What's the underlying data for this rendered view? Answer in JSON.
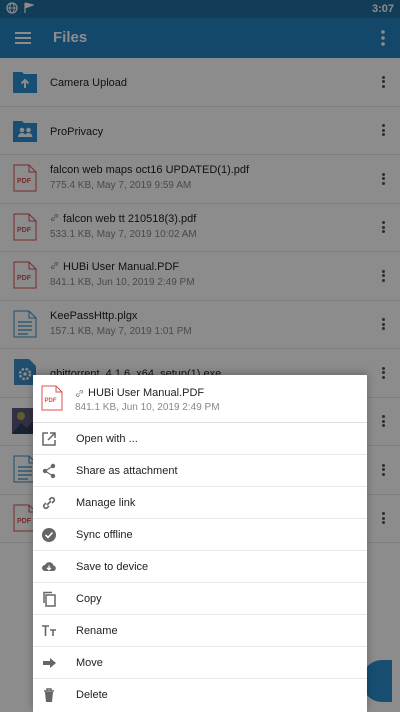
{
  "status": {
    "time": "3:07"
  },
  "appbar": {
    "title": "Files"
  },
  "files": [
    {
      "name": "Camera Upload",
      "meta": "",
      "type": "folder-upload",
      "linked": false
    },
    {
      "name": "ProPrivacy",
      "meta": "",
      "type": "folder-shared",
      "linked": false
    },
    {
      "name": "falcon web maps oct16 UPDATED(1).pdf",
      "meta": "775.4 KB, May 7, 2019 9:59 AM",
      "type": "pdf",
      "linked": false
    },
    {
      "name": "falcon web tt 210518(3).pdf",
      "meta": "533.1 KB, May 7, 2019 10:02 AM",
      "type": "pdf",
      "linked": true
    },
    {
      "name": "HUBi User Manual.PDF",
      "meta": "841.1 KB, Jun 10, 2019 2:49 PM",
      "type": "pdf",
      "linked": true
    },
    {
      "name": "KeePassHttp.plgx",
      "meta": "157.1 KB, May 7, 2019 1:01 PM",
      "type": "doc",
      "linked": false
    },
    {
      "name": "qbittorrent_4.1.6_x64_setup(1).exe",
      "meta": "",
      "type": "exe",
      "linked": false
    },
    {
      "name": "",
      "meta": "",
      "type": "image",
      "linked": false
    },
    {
      "name": "",
      "meta": "",
      "type": "doc",
      "linked": false
    },
    {
      "name": "",
      "meta": "",
      "type": "pdf",
      "linked": false
    }
  ],
  "sheet": {
    "file_name": "HUBi User Manual.PDF",
    "file_meta": "841.1 KB, Jun 10, 2019 2:49 PM",
    "actions": [
      {
        "label": "Open with ...",
        "icon": "open-with-icon"
      },
      {
        "label": "Share as attachment",
        "icon": "share-icon"
      },
      {
        "label": "Manage link",
        "icon": "link-icon"
      },
      {
        "label": "Sync offline",
        "icon": "check-circle-icon"
      },
      {
        "label": "Save to device",
        "icon": "cloud-download-icon"
      },
      {
        "label": "Copy",
        "icon": "copy-icon"
      },
      {
        "label": "Rename",
        "icon": "rename-icon"
      },
      {
        "label": "Move",
        "icon": "move-arrow-icon"
      },
      {
        "label": "Delete",
        "icon": "trash-icon"
      }
    ]
  },
  "colors": {
    "primary": "#2684c4",
    "status_bar": "#1f6fa3",
    "pdf_red": "#d9534f",
    "folder_blue": "#2b8fd4"
  }
}
